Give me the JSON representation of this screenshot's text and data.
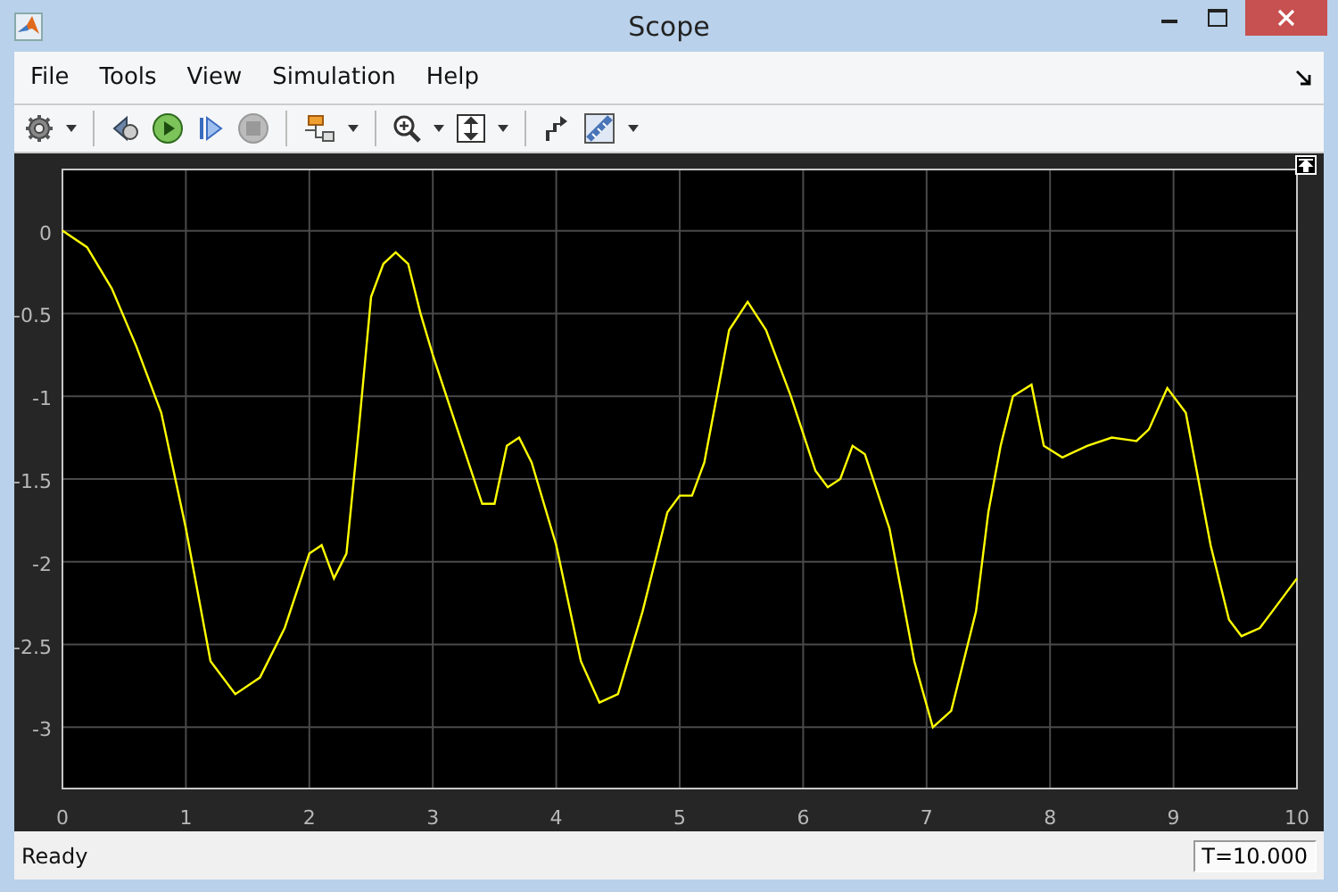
{
  "window": {
    "title": "Scope"
  },
  "menu": [
    "File",
    "Tools",
    "View",
    "Simulation",
    "Help"
  ],
  "plot": {
    "chart_data": {
      "type": "line",
      "x": [
        0,
        0.2,
        0.4,
        0.6,
        0.8,
        1.0,
        1.2,
        1.4,
        1.6,
        1.8,
        2.0,
        2.1,
        2.2,
        2.3,
        2.4,
        2.5,
        2.6,
        2.7,
        2.8,
        2.9,
        3.0,
        3.2,
        3.4,
        3.5,
        3.6,
        3.7,
        3.8,
        4.0,
        4.2,
        4.35,
        4.5,
        4.7,
        4.9,
        5.0,
        5.1,
        5.2,
        5.3,
        5.4,
        5.55,
        5.7,
        5.9,
        6.1,
        6.2,
        6.3,
        6.4,
        6.5,
        6.7,
        6.9,
        7.05,
        7.2,
        7.4,
        7.5,
        7.6,
        7.7,
        7.85,
        7.95,
        8.1,
        8.3,
        8.5,
        8.7,
        8.8,
        8.95,
        9.1,
        9.3,
        9.45,
        9.55,
        9.7,
        9.8,
        10
      ],
      "series": [
        {
          "color": "#ffff00",
          "values": [
            0,
            -0.1,
            -0.35,
            -0.7,
            -1.1,
            -1.8,
            -2.6,
            -2.8,
            -2.7,
            -2.4,
            -1.95,
            -1.9,
            -2.1,
            -1.95,
            -1.2,
            -0.4,
            -0.2,
            -0.13,
            -0.2,
            -0.5,
            -0.75,
            -1.2,
            -1.65,
            -1.65,
            -1.3,
            -1.25,
            -1.4,
            -1.9,
            -2.6,
            -2.85,
            -2.8,
            -2.3,
            -1.7,
            -1.6,
            -1.6,
            -1.4,
            -1.0,
            -0.6,
            -0.43,
            -0.6,
            -1.0,
            -1.45,
            -1.55,
            -1.5,
            -1.3,
            -1.35,
            -1.8,
            -2.6,
            -3.0,
            -2.9,
            -2.3,
            -1.7,
            -1.3,
            -1.0,
            -0.93,
            -1.3,
            -1.37,
            -1.3,
            -1.25,
            -1.27,
            -1.2,
            -0.95,
            -1.1,
            -1.9,
            -2.35,
            -2.45,
            -2.4,
            -2.3,
            -2.1
          ]
        }
      ],
      "xlim": [
        0,
        10
      ],
      "ylim": [
        -3.37,
        0.37
      ],
      "xticks": [
        0,
        1,
        2,
        3,
        4,
        5,
        6,
        7,
        8,
        9,
        10
      ],
      "yticks": [
        -3,
        -2.5,
        -2,
        -1.5,
        -1,
        -0.5,
        0
      ],
      "grid": true
    }
  },
  "status_bar": {
    "text": "Ready",
    "time": "T=10.000"
  }
}
